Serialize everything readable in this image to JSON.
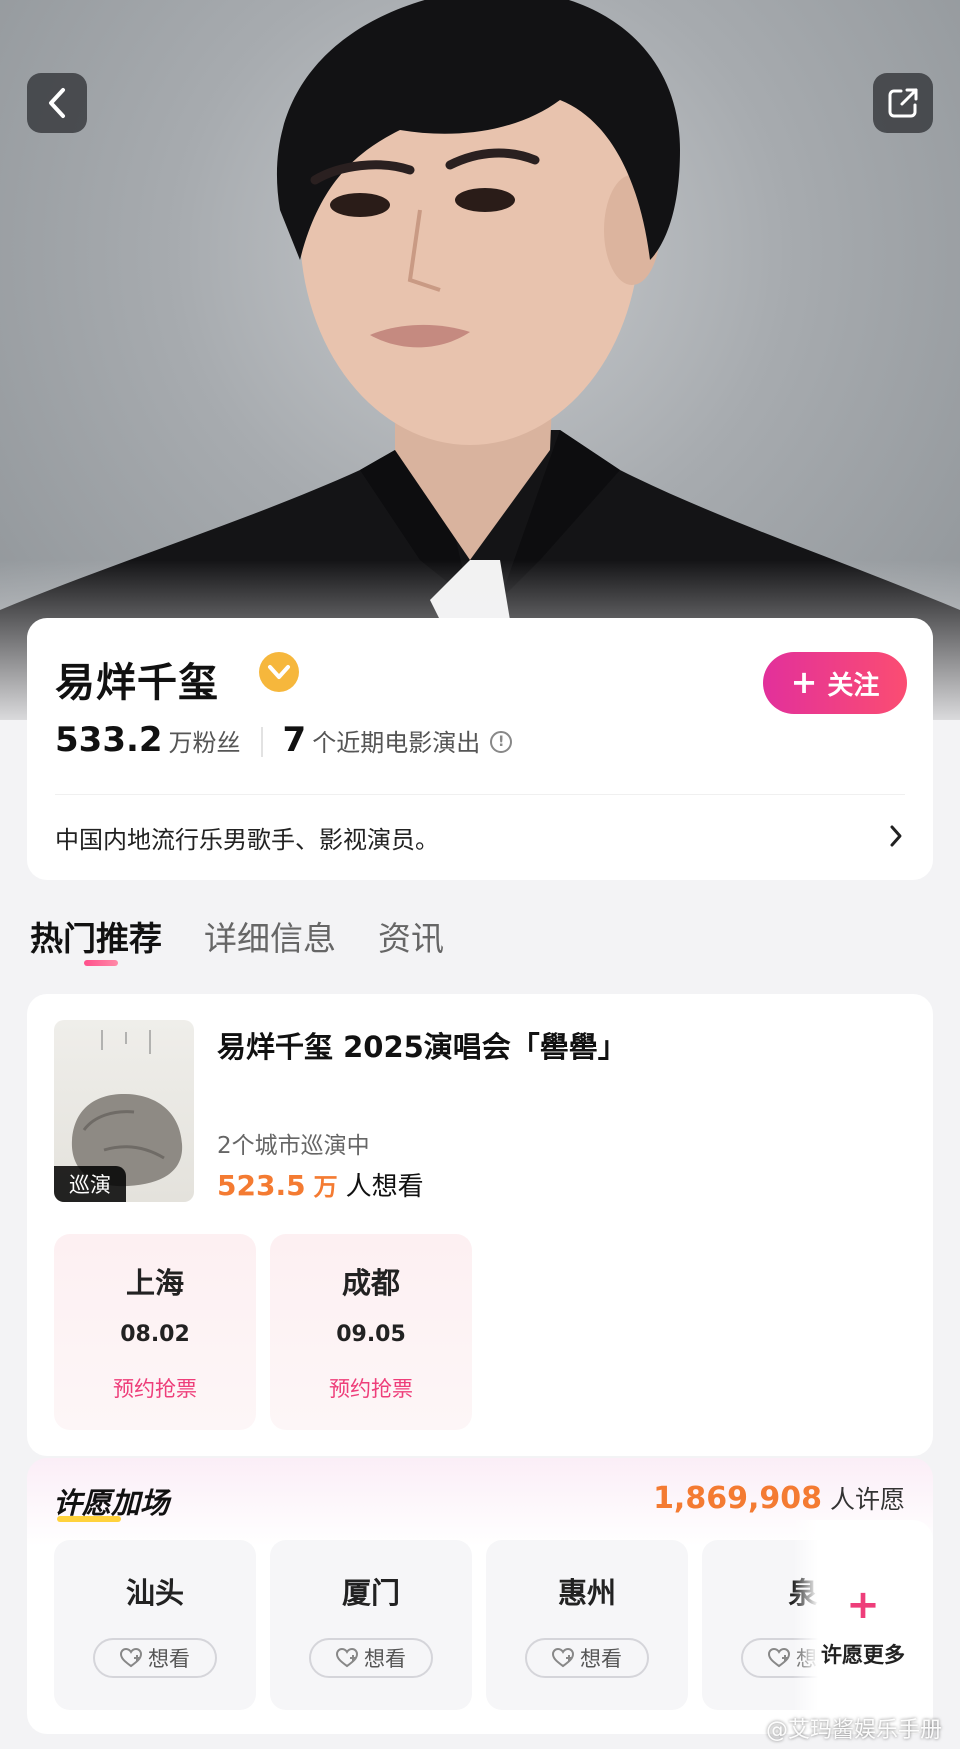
{
  "header": {
    "back_icon": "chevron-left-icon",
    "share_icon": "share-icon"
  },
  "profile": {
    "name": "易烊千玺",
    "verified_icon": "verified-badge-icon",
    "follow_label": "关注",
    "fans_count": "533.2",
    "fans_unit": "万粉丝",
    "recent_count": "7",
    "recent_label": "个近期电影演出",
    "bio": "中国内地流行乐男歌手、影视演员。"
  },
  "tabs": [
    {
      "label": "热门推荐",
      "active": true
    },
    {
      "label": "详细信息",
      "active": false
    },
    {
      "label": "资讯",
      "active": false
    }
  ],
  "concert": {
    "title": "易烊千玺 2025演唱会「嚳嚳」",
    "tag": "巡演",
    "subtitle": "2个城市巡演中",
    "want_count": "523.5",
    "want_unit": "万",
    "want_label": "人想看",
    "cities": [
      {
        "name": "上海",
        "date": "08.02",
        "action": "预约抢票"
      },
      {
        "name": "成都",
        "date": "09.05",
        "action": "预约抢票"
      }
    ]
  },
  "wish": {
    "title": "许愿加场",
    "count": "1,869,908",
    "count_label": "人许愿",
    "cities": [
      {
        "name": "汕头",
        "button": "想看"
      },
      {
        "name": "厦门",
        "button": "想看"
      },
      {
        "name": "惠州",
        "button": "想看"
      },
      {
        "name": "泉",
        "button": "想看"
      }
    ],
    "more_label": "许愿更多"
  },
  "watermark": "@艾玛酱娱乐手册",
  "colors": {
    "accent_pink": "#ee3e7a",
    "accent_orange": "#f47b32",
    "verified_gold": "#f6b73c"
  }
}
